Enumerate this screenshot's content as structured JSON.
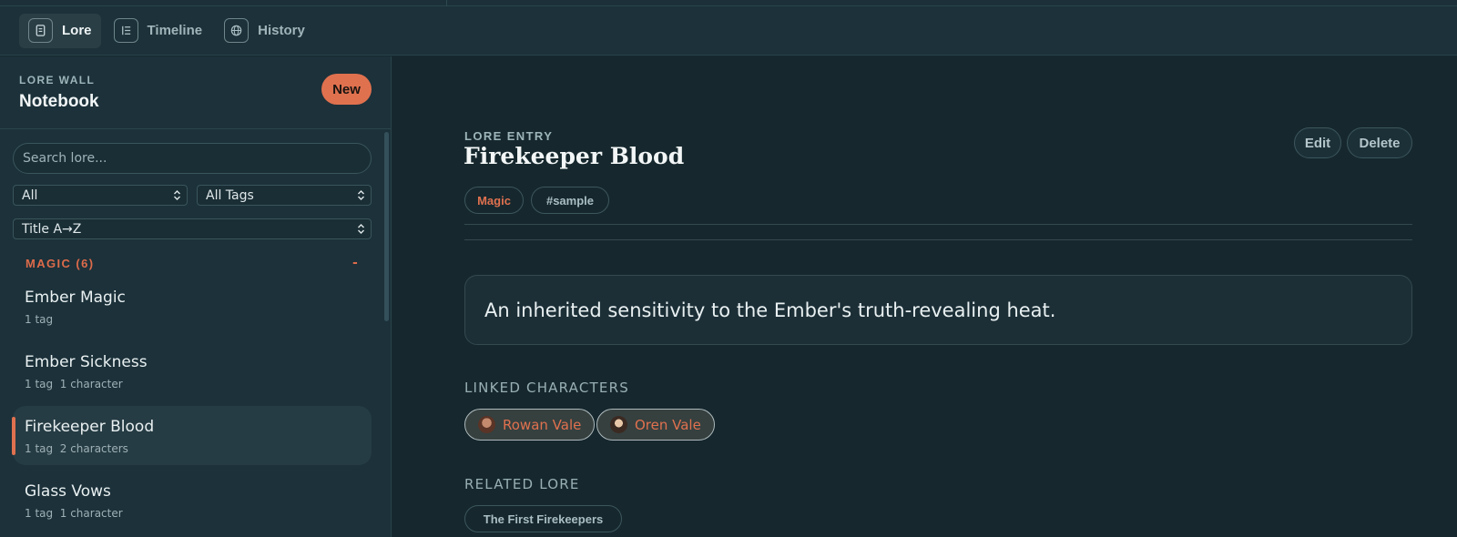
{
  "nav": {
    "tabs": [
      {
        "label": "Lore",
        "icon": "notebook-icon",
        "active": true
      },
      {
        "label": "Timeline",
        "icon": "timeline-list-icon",
        "active": false
      },
      {
        "label": "History",
        "icon": "globe-icon",
        "active": false
      }
    ]
  },
  "sidebar": {
    "eyebrow": "LORE WALL",
    "title": "Notebook",
    "new_label": "New",
    "search_placeholder": "Search lore...",
    "filters": {
      "category": "All",
      "tags": "All Tags",
      "sort": "Title A→Z"
    },
    "group": {
      "label": "MAGIC (6)",
      "toggle": "-"
    },
    "items": [
      {
        "name": "Ember Magic",
        "meta": "1 tag",
        "selected": false
      },
      {
        "name": "Ember Sickness",
        "meta": "1 tag  1 character",
        "selected": false
      },
      {
        "name": "Firekeeper Blood",
        "meta": "1 tag  2 characters",
        "selected": true
      },
      {
        "name": "Glass Vows",
        "meta": "1 tag  1 character",
        "selected": false
      }
    ]
  },
  "entry": {
    "eyebrow": "LORE ENTRY",
    "title": "Firekeeper Blood",
    "category_tag": "Magic",
    "hashtag": "#sample",
    "edit_label": "Edit",
    "delete_label": "Delete",
    "summary": "An inherited sensitivity to the Ember's truth-revealing heat.",
    "linked_characters_label": "LINKED CHARACTERS",
    "linked_characters": [
      {
        "name": "Rowan Vale"
      },
      {
        "name": "Oren Vale"
      }
    ],
    "related_lore_label": "RELATED LORE",
    "related_lore": [
      {
        "title": "The First Firekeepers"
      }
    ]
  },
  "colors": {
    "accent": "#e0714f",
    "background": "#16282e",
    "sidebar": "#1c313a"
  }
}
